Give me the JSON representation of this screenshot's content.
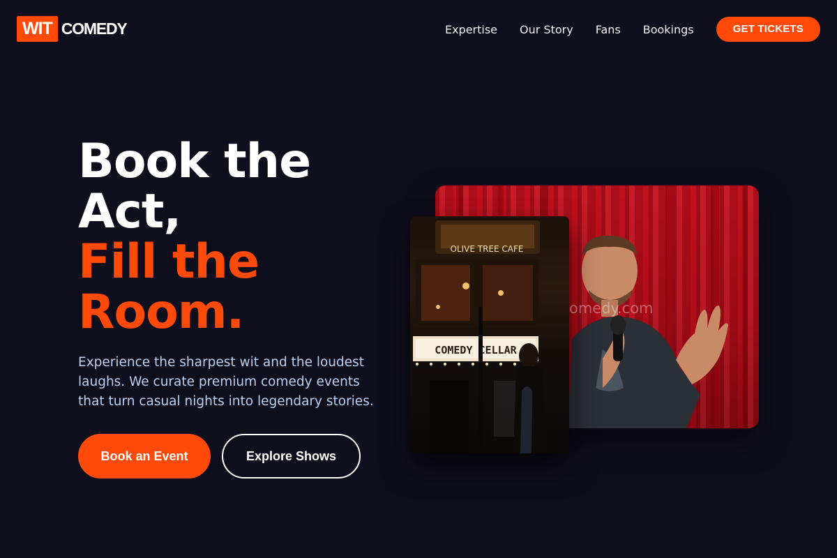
{
  "logo": {
    "box": "WIT",
    "word": "COMEDY"
  },
  "nav": {
    "links": [
      "Expertise",
      "Our Story",
      "Fans",
      "Bookings"
    ],
    "cta": "GET TICKETS"
  },
  "hero": {
    "line1": "Book the",
    "line2": "Act,",
    "line3": "Fill the",
    "line4": "Room.",
    "lede": "Experience the sharpest wit and the loudest laughs. We curate premium comedy events that turn casual nights into legendary stories.",
    "primary_button": "Book an Event",
    "secondary_button": "Explore Shows"
  },
  "photos": {
    "side_sign_top": "OLIVE TREE CAFE",
    "side_sign": "COMEDY CELLAR",
    "main_caption": "omedy.com"
  },
  "colors": {
    "accent": "#ff4a0a",
    "background": "#0f0e1c",
    "lede": "#bcd0ee"
  }
}
